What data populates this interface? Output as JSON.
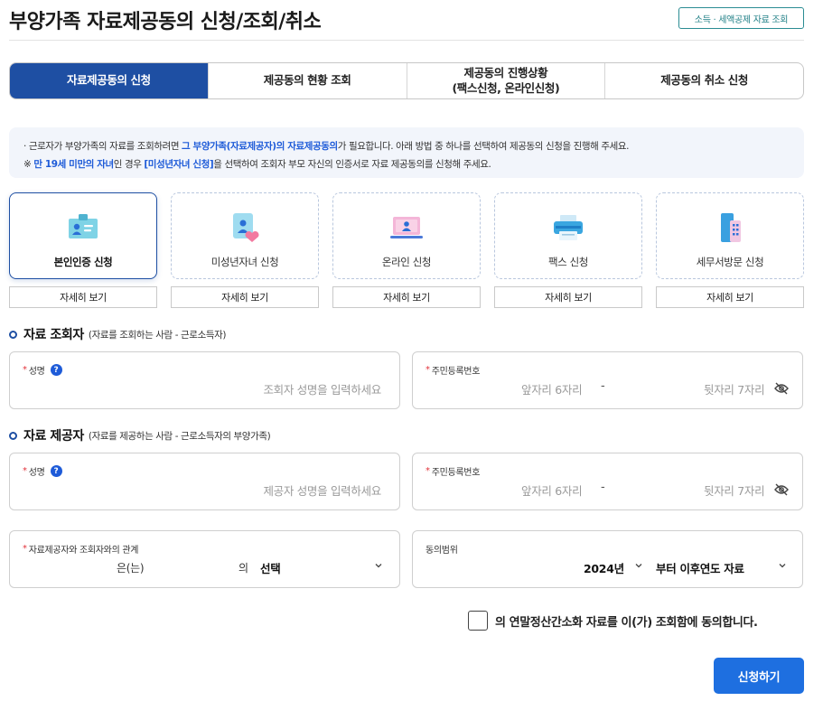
{
  "page": {
    "title": "부양가족 자료제공동의 신청/조회/취소",
    "badge": "소득 · 세액공제 자료 조회"
  },
  "tabs": [
    {
      "label": "자료제공동의 신청",
      "active": true
    },
    {
      "label": "제공동의 현황 조회",
      "active": false
    },
    {
      "label": "제공동의 진행상황\n(팩스신청, 온라인신청)",
      "active": false
    },
    {
      "label": "제공동의 취소 신청",
      "active": false
    }
  ],
  "notice": {
    "line1_a": "· 근로자가 부양가족의 자료를 조회하려면 ",
    "line1_hl": "그 부양가족(자료제공자)의 자료제공동의",
    "line1_b": "가 필요합니다. 아래 방법 중 하나를 선택하여 제공동의 신청을 진행해 주세요.",
    "line2_a": "※ ",
    "line2_hl1": "만 19세 미만의 자녀",
    "line2_b": "인 경우 ",
    "line2_hl2": "[미성년자녀 신청]",
    "line2_c": "을 선택하여 조회자 부모 자신의 인증서로 자료 제공동의를 신청해 주세요."
  },
  "methods": [
    {
      "label": "본인인증 신청",
      "icon": "id-card-icon",
      "active": true,
      "detail": "자세히 보기"
    },
    {
      "label": "미성년자녀 신청",
      "icon": "child-heart-icon",
      "active": false,
      "detail": "자세히 보기"
    },
    {
      "label": "온라인 신청",
      "icon": "laptop-icon",
      "active": false,
      "detail": "자세히 보기"
    },
    {
      "label": "팩스 신청",
      "icon": "fax-printer-icon",
      "active": false,
      "detail": "자세히 보기"
    },
    {
      "label": "세무서방문 신청",
      "icon": "building-icon",
      "active": false,
      "detail": "자세히 보기"
    }
  ],
  "inquirer": {
    "title": "자료 조회자",
    "subtitle": "(자료를 조회하는 사람 - 근로소득자)",
    "name_label": "성명",
    "name_placeholder": "조회자 성명을 입력하세요",
    "rrn_label": "주민등록번호",
    "rrn_front_placeholder": "앞자리 6자리",
    "rrn_sep": "-",
    "rrn_back_placeholder": "뒷자리 7자리"
  },
  "provider": {
    "title": "자료 제공자",
    "subtitle": "(자료를 제공하는 사람 - 근로소득자의 부양가족)",
    "name_label": "성명",
    "name_placeholder": "제공자 성명을 입력하세요",
    "rrn_label": "주민등록번호",
    "rrn_front_placeholder": "앞자리 6자리",
    "rrn_sep": "-",
    "rrn_back_placeholder": "뒷자리 7자리"
  },
  "relation": {
    "label": "자료제공자와 조회자와의 관계",
    "text_a": "은(는)",
    "text_b": "의",
    "selected": "선택"
  },
  "scope": {
    "label": "동의범위",
    "year": "2024년",
    "range": "부터 이후연도 자료"
  },
  "agree": {
    "text": "의 연말정산간소화 자료를 이(가) 조회함에 동의합니다."
  },
  "submit": {
    "label": "신청하기"
  },
  "colors": {
    "primary": "#1e4fa3",
    "button": "#1e6fe0",
    "highlight": "#1e5bd8",
    "required": "#e2333b"
  }
}
